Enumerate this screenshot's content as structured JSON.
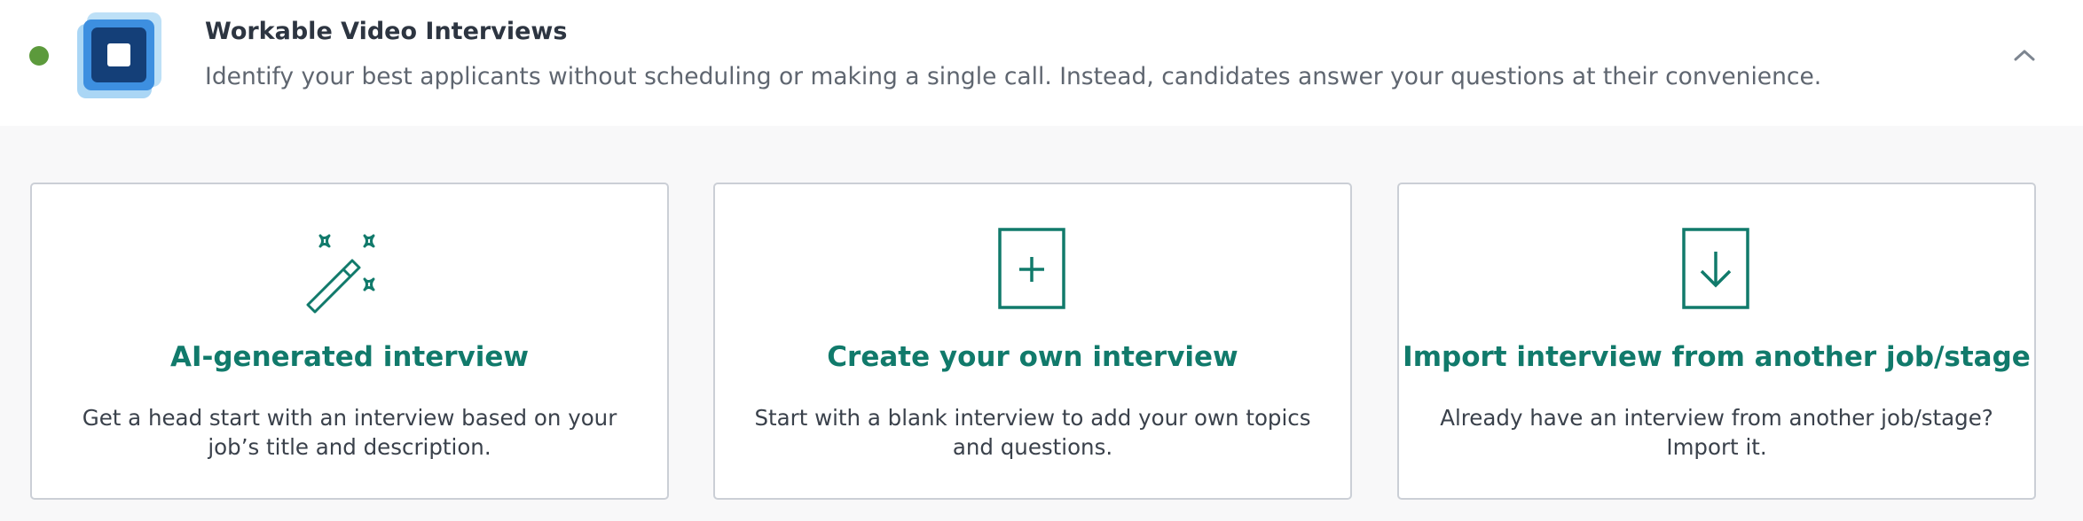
{
  "header": {
    "title": "Workable Video Interviews",
    "description": "Identify your best applicants without scheduling or making a single call. Instead, candidates answer your questions at their convenience.",
    "status_color": "#5c9a3c",
    "logo_icon": "video-interview-logo",
    "collapse_icon": "chevron-up-icon"
  },
  "options": [
    {
      "icon": "magic-wand-icon",
      "title": "AI-generated interview",
      "description": "Get a head start with an interview based on your job’s title and description."
    },
    {
      "icon": "plus-document-icon",
      "title": "Create your own interview",
      "description": "Start with a blank interview to add your own topics and questions."
    },
    {
      "icon": "import-down-arrow-icon",
      "title": "Import interview from another job/stage",
      "description": "Already have an interview from another job/stage? Import it."
    }
  ],
  "colors": {
    "accent": "#117a6b",
    "title_text": "#2d3541",
    "muted_text": "#5f6670",
    "card_border": "#cbcfd6",
    "page_bg": "#f8f8f9"
  }
}
